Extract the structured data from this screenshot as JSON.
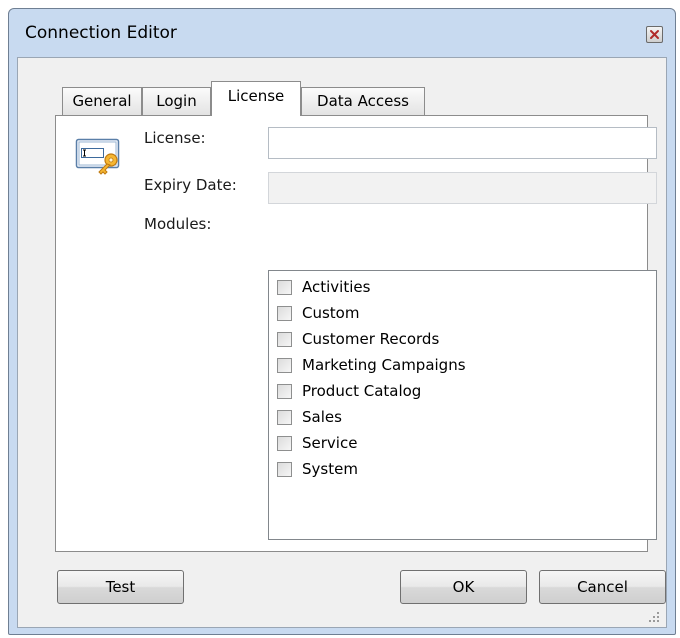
{
  "window": {
    "title": "Connection Editor"
  },
  "tabs": [
    {
      "label": "General",
      "active": false
    },
    {
      "label": "Login",
      "active": false
    },
    {
      "label": "License",
      "active": true
    },
    {
      "label": "Data Access",
      "active": false
    }
  ],
  "license": {
    "license_label": "License:",
    "license_value": "",
    "expiry_label": "Expiry Date:",
    "expiry_value": "",
    "modules_label": "Modules:",
    "modules": [
      {
        "label": "Activities",
        "checked": false
      },
      {
        "label": "Custom",
        "checked": false
      },
      {
        "label": "Customer Records",
        "checked": false
      },
      {
        "label": "Marketing Campaigns",
        "checked": false
      },
      {
        "label": "Product Catalog",
        "checked": false
      },
      {
        "label": "Sales",
        "checked": false
      },
      {
        "label": "Service",
        "checked": false
      },
      {
        "label": "System",
        "checked": false
      }
    ]
  },
  "buttons": {
    "test": "Test",
    "ok": "OK",
    "cancel": "Cancel"
  },
  "icons": {
    "close": "close-icon",
    "license": "license-key-icon",
    "grip": "resize-grip-icon"
  },
  "colors": {
    "window_frame": "#c8daf0",
    "client_bg": "#f0f0f0",
    "close_x": "#c23b3b"
  }
}
